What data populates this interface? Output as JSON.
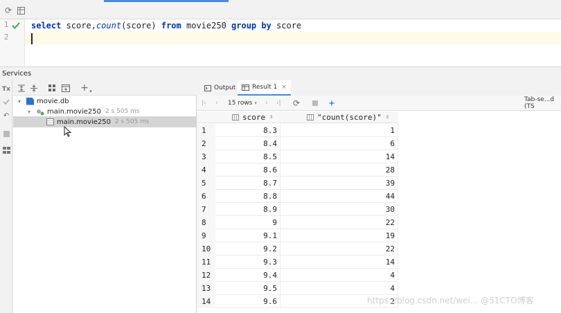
{
  "editor": {
    "line_numbers": [
      "1",
      "2"
    ],
    "query_tokens": [
      {
        "text": "select",
        "kind": "kw"
      },
      {
        "text": " score,",
        "kind": "id"
      },
      {
        "text": "count",
        "kind": "fn"
      },
      {
        "text": "(score) ",
        "kind": "id"
      },
      {
        "text": "from",
        "kind": "kw"
      },
      {
        "text": " movie250 ",
        "kind": "id"
      },
      {
        "text": "group by",
        "kind": "kw"
      },
      {
        "text": " score",
        "kind": "id"
      }
    ]
  },
  "services": {
    "title": "Services",
    "tree": [
      {
        "label": "movie.db",
        "meta": ""
      },
      {
        "label": "main.movie250",
        "meta": "2 s 505 ms"
      },
      {
        "label": "main.movie250",
        "meta": "2 s 505 ms"
      }
    ]
  },
  "results": {
    "tabs": [
      {
        "label": "Output",
        "icon": "console-icon"
      },
      {
        "label": "Result 1",
        "icon": "table-icon"
      }
    ],
    "rows_label": "15 rows",
    "mode_label": "Tab-se...d (TS",
    "columns": [
      "score",
      "\"count(score)\""
    ],
    "rows": [
      [
        "8.3",
        "1"
      ],
      [
        "8.4",
        "6"
      ],
      [
        "8.5",
        "14"
      ],
      [
        "8.6",
        "28"
      ],
      [
        "8.7",
        "39"
      ],
      [
        "8.8",
        "44"
      ],
      [
        "8.9",
        "30"
      ],
      [
        "9",
        "22"
      ],
      [
        "9.1",
        "19"
      ],
      [
        "9.2",
        "22"
      ],
      [
        "9.3",
        "14"
      ],
      [
        "9.4",
        "4"
      ],
      [
        "9.5",
        "4"
      ],
      [
        "9.6",
        "2"
      ]
    ]
  },
  "watermark": "https://blog.csdn.net/wei... @51CTO博客",
  "colors": {
    "keyword": "#0033b3",
    "accent": "#4a88e2",
    "selection": "#d5d5d5"
  }
}
